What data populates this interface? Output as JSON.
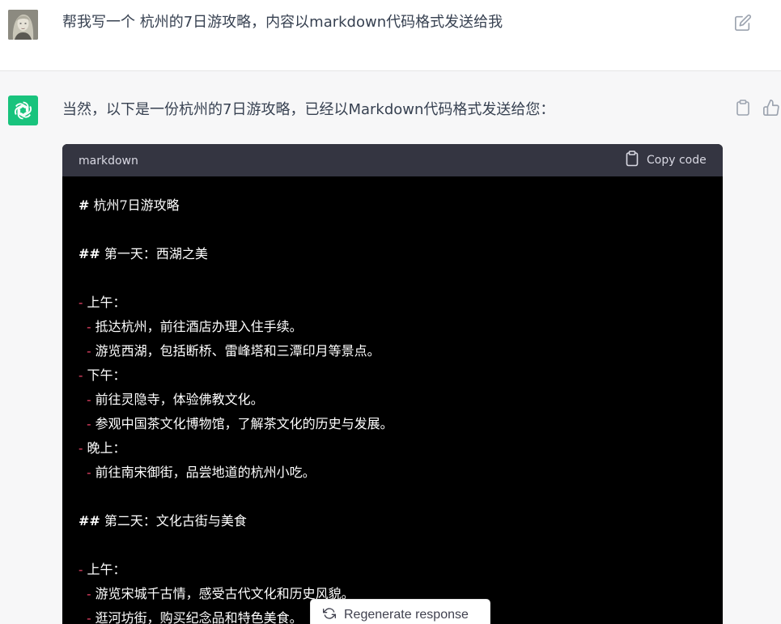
{
  "user_message": {
    "text": "帮我写一个 杭州的7日游攻略，内容以markdown代码格式发送给我",
    "avatar_icon": "user-avatar-portrait",
    "edit_icon": "edit-icon"
  },
  "assistant_message": {
    "intro": "当然，以下是一份杭州的7日游攻略，已经以Markdown代码格式发送给您：",
    "avatar_icon": "openai-logo-icon",
    "avatar_color": "#19c37d",
    "copy_icon": "clipboard-icon",
    "thumbs_icon": "thumbs-up-icon"
  },
  "code_block": {
    "language": "markdown",
    "copy_label": "Copy code",
    "dash_color": "#f0466a",
    "lines": [
      {
        "marker": "#",
        "text": "杭州7日游攻略"
      },
      {
        "marker": "",
        "text": ""
      },
      {
        "marker": "##",
        "text": "第一天：西湖之美"
      },
      {
        "marker": "",
        "text": ""
      },
      {
        "marker": "-",
        "text": "上午："
      },
      {
        "marker": "  -",
        "text": "抵达杭州，前往酒店办理入住手续。"
      },
      {
        "marker": "  -",
        "text": "游览西湖，包括断桥、雷峰塔和三潭印月等景点。"
      },
      {
        "marker": "-",
        "text": "下午："
      },
      {
        "marker": "  -",
        "text": "前往灵隐寺，体验佛教文化。"
      },
      {
        "marker": "  -",
        "text": "参观中国茶文化博物馆，了解茶文化的历史与发展。"
      },
      {
        "marker": "-",
        "text": "晚上："
      },
      {
        "marker": "  -",
        "text": "前往南宋御街，品尝地道的杭州小吃。"
      },
      {
        "marker": "",
        "text": ""
      },
      {
        "marker": "##",
        "text": "第二天：文化古街与美食"
      },
      {
        "marker": "",
        "text": ""
      },
      {
        "marker": "-",
        "text": "上午："
      },
      {
        "marker": "  -",
        "text": "游览宋城千古情，感受古代文化和历史风貌。"
      },
      {
        "marker": "  -",
        "text": "逛河坊街，购买纪念品和特色美食。"
      }
    ]
  },
  "regenerate": {
    "label": "Regenerate response",
    "icon": "refresh-icon"
  }
}
